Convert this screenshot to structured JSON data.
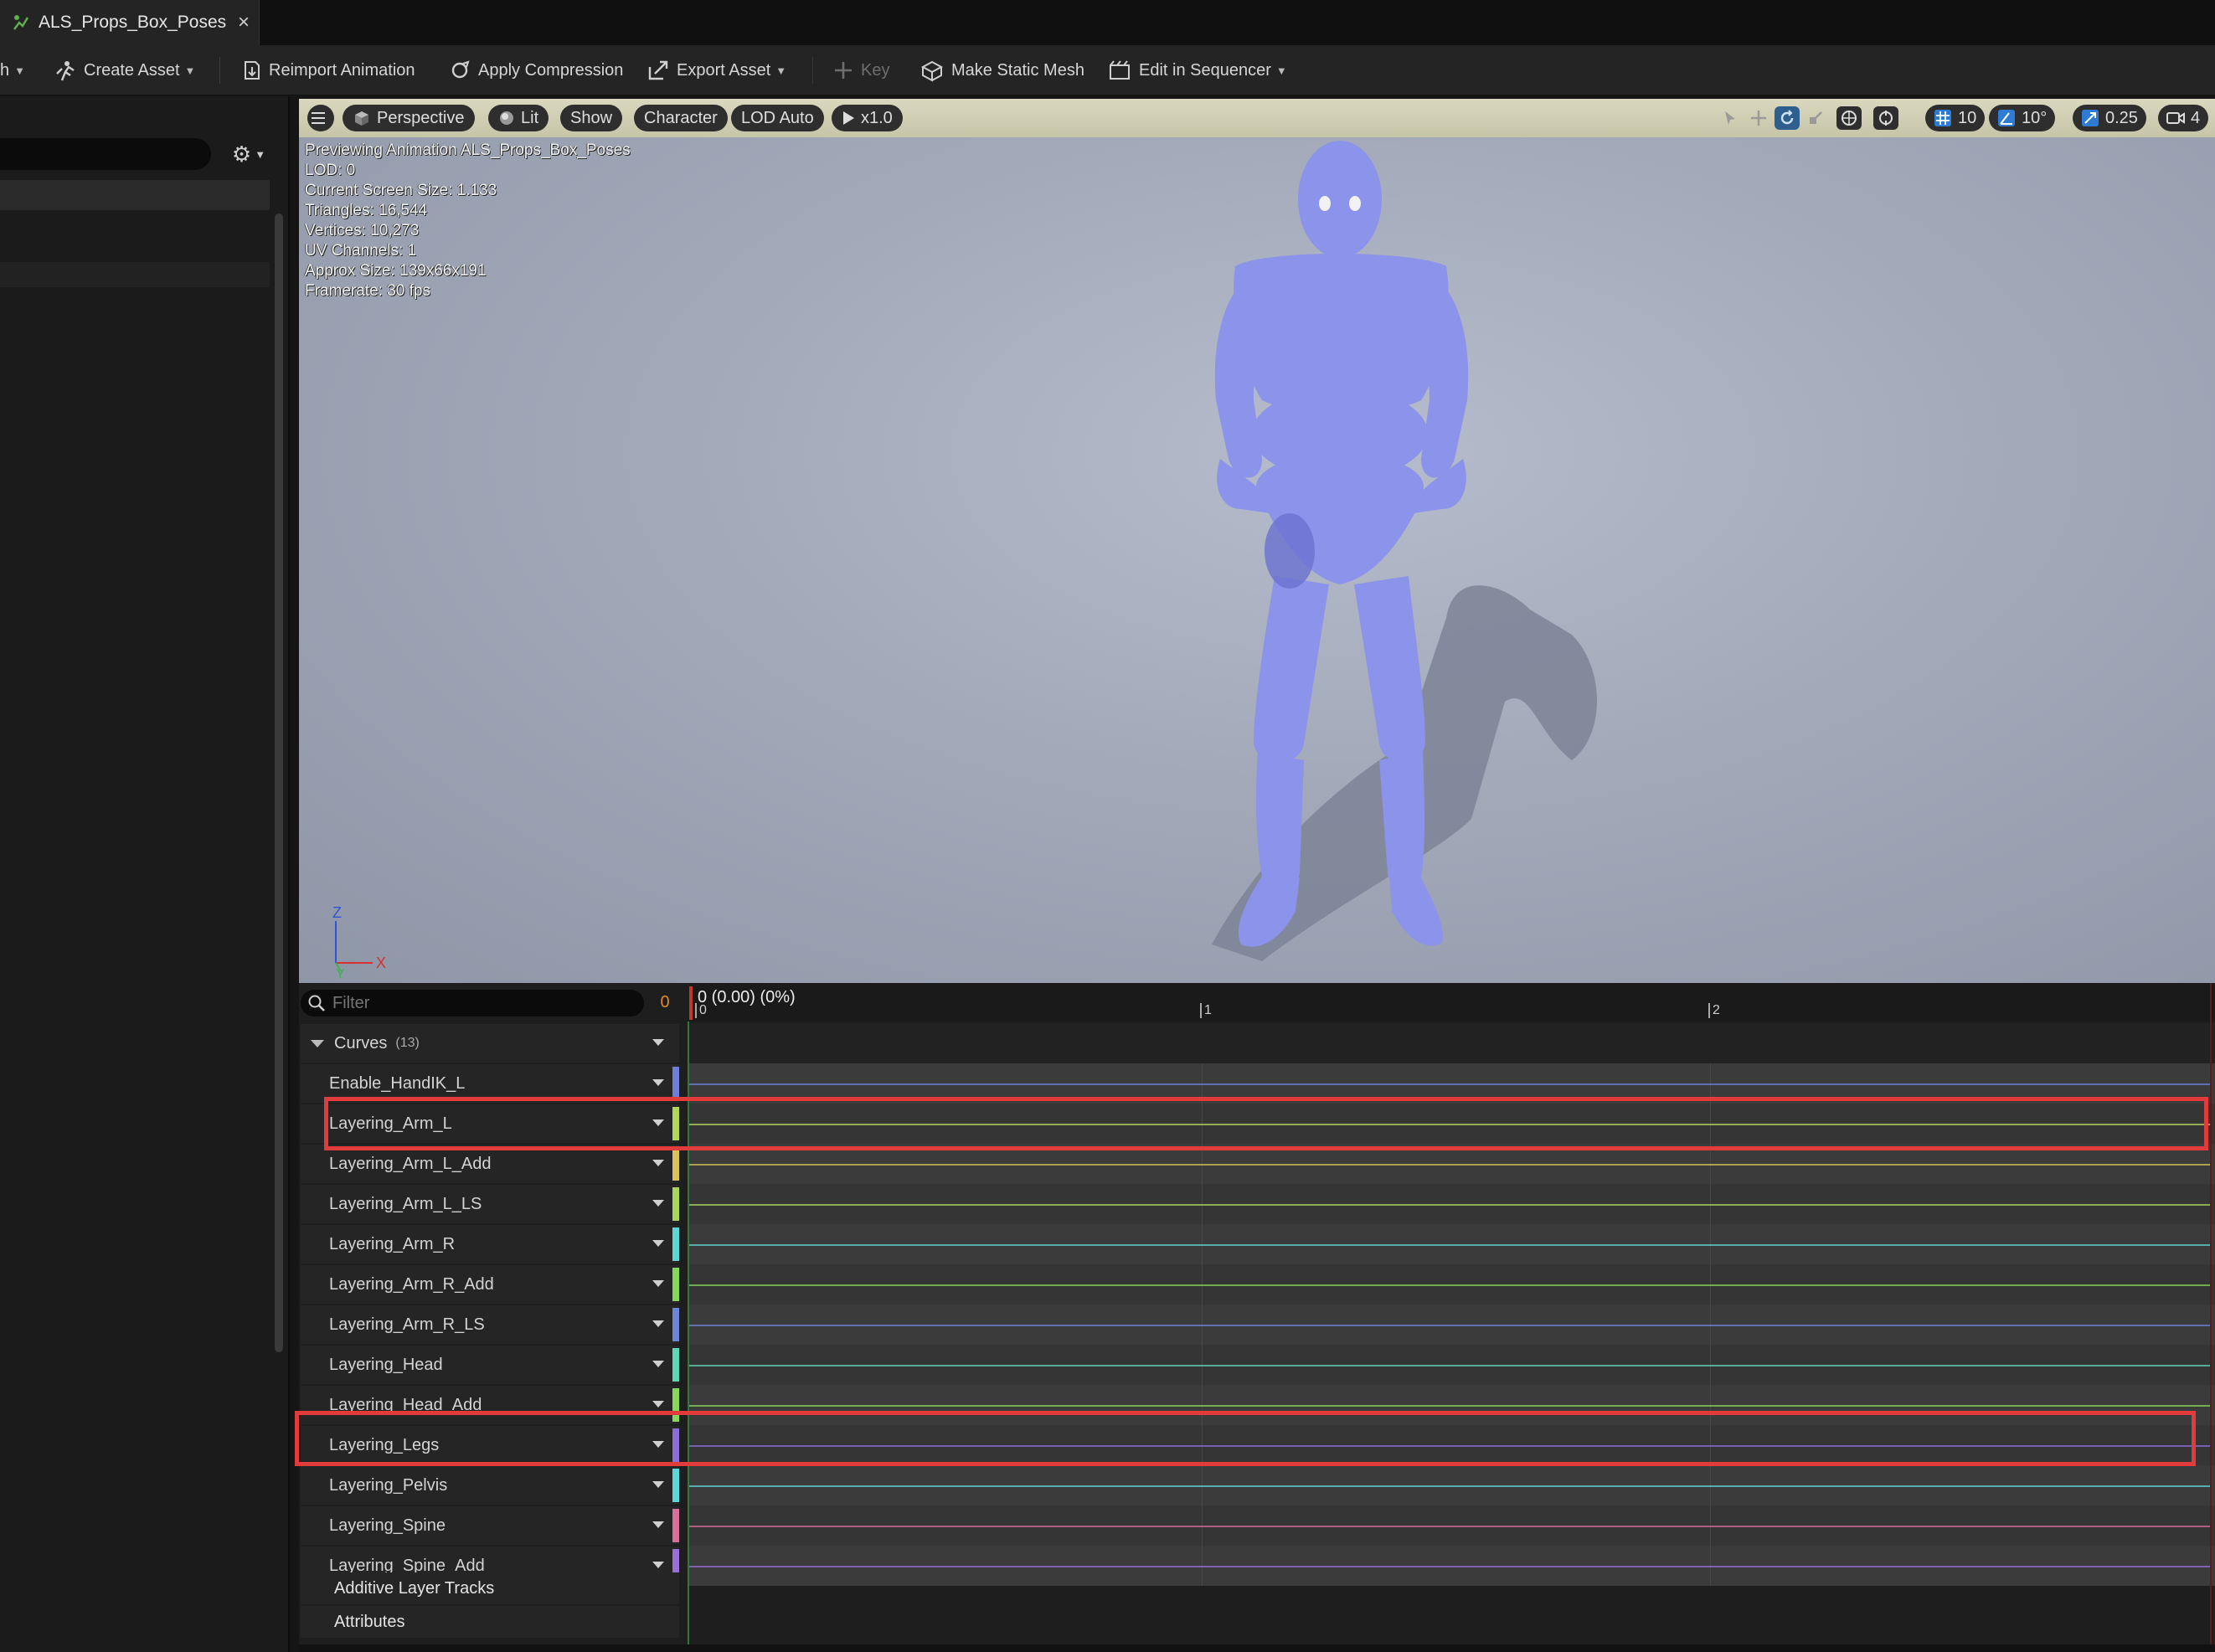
{
  "tab": {
    "title": "ALS_Props_Box_Poses",
    "close": "×"
  },
  "toolbar": {
    "partial_menu": "h",
    "create_asset": "Create Asset",
    "reimport": "Reimport Animation",
    "apply_compression": "Apply Compression",
    "export_asset": "Export Asset",
    "key": "Key",
    "make_static_mesh": "Make Static Mesh",
    "edit_in_sequencer": "Edit in Sequencer"
  },
  "viewport": {
    "perspective": "Perspective",
    "lit": "Lit",
    "show": "Show",
    "character": "Character",
    "lod": "LOD Auto",
    "speed": "x1.0",
    "grid_snap": "10",
    "rotation_snap": "10°",
    "scale_snap": "0.25",
    "camera_speed": "4",
    "stats": [
      "Previewing Animation ALS_Props_Box_Poses",
      "LOD: 0",
      "Current Screen Size: 1.133",
      "Triangles: 16,544",
      "Vertices: 10,273",
      "UV Channels: 1",
      "Approx Size: 139x66x191",
      "Framerate: 30 fps"
    ],
    "axis": {
      "z": "Z",
      "x": "X",
      "y": "Y"
    }
  },
  "timeline": {
    "filter_placeholder": "Filter",
    "count": "0",
    "time_label": "0 (0.00) (0%)",
    "ticks": [
      "0",
      "1",
      "2"
    ],
    "curves_header": "Curves",
    "curves_count": "(13)",
    "tracks": [
      {
        "name": "Enable_HandIK_L",
        "color": "#6f7fd8"
      },
      {
        "name": "Layering_Arm_L",
        "color": "#b5d45a"
      },
      {
        "name": "Layering_Arm_L_Add",
        "color": "#d8c45a"
      },
      {
        "name": "Layering_Arm_L_LS",
        "color": "#a9d65c"
      },
      {
        "name": "Layering_Arm_R",
        "color": "#5fd6d2"
      },
      {
        "name": "Layering_Arm_R_Add",
        "color": "#86d65a"
      },
      {
        "name": "Layering_Arm_R_LS",
        "color": "#6d84d8"
      },
      {
        "name": "Layering_Head",
        "color": "#5fd6b4"
      },
      {
        "name": "Layering_Head_Add",
        "color": "#8ad65a"
      },
      {
        "name": "Layering_Legs",
        "color": "#8a6fd8"
      },
      {
        "name": "Layering_Pelvis",
        "color": "#5fd6d8"
      },
      {
        "name": "Layering_Spine",
        "color": "#d86f9a"
      },
      {
        "name": "Layering_Spine_Add",
        "color": "#9a6fd8"
      }
    ],
    "additive_layer_tracks": "Additive Layer Tracks",
    "attributes": "Attributes"
  }
}
